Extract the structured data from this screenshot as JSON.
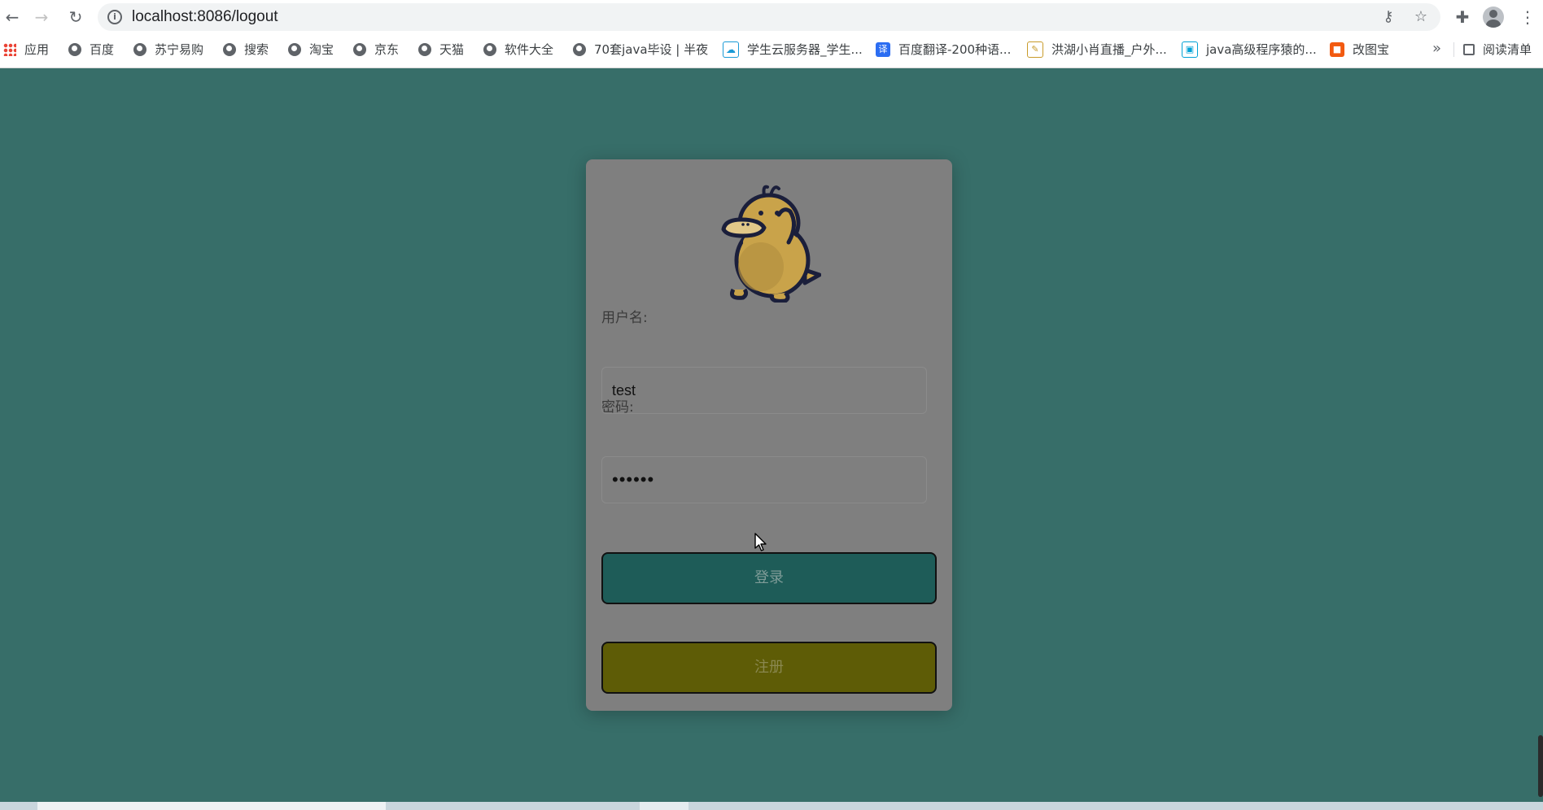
{
  "browser": {
    "url": "localhost:8086/logout",
    "icons": {
      "back": "arrow-left-icon",
      "forward": "arrow-right-icon",
      "reload": "reload-icon",
      "info": "info-icon",
      "key": "key-icon",
      "star": "star-icon",
      "extensions": "puzzle-icon",
      "profile": "profile-icon",
      "menu": "kebab-menu-icon"
    }
  },
  "bookmarks": {
    "items": [
      {
        "label": "应用"
      },
      {
        "label": "百度"
      },
      {
        "label": "苏宁易购"
      },
      {
        "label": "搜索"
      },
      {
        "label": "淘宝"
      },
      {
        "label": "京东"
      },
      {
        "label": "天猫"
      },
      {
        "label": "软件大全"
      },
      {
        "label": "70套java毕设 | 半夜"
      },
      {
        "label": "学生云服务器_学生..."
      },
      {
        "label": "百度翻译-200种语..."
      },
      {
        "label": "洪湖小肖直播_户外..."
      },
      {
        "label": "java高级程序猿的..."
      },
      {
        "label": "改图宝"
      }
    ],
    "more": "»",
    "reading_list": "阅读清单"
  },
  "login": {
    "username_label": "用户名:",
    "username_value": "test",
    "password_label": "密码:",
    "password_value": "••••••",
    "login_button": "登录",
    "register_button": "注册"
  },
  "colors": {
    "background": "#376e69",
    "card": "#7f7f7f",
    "login_button": "#1e5c58",
    "register_button": "#5e5c06"
  }
}
